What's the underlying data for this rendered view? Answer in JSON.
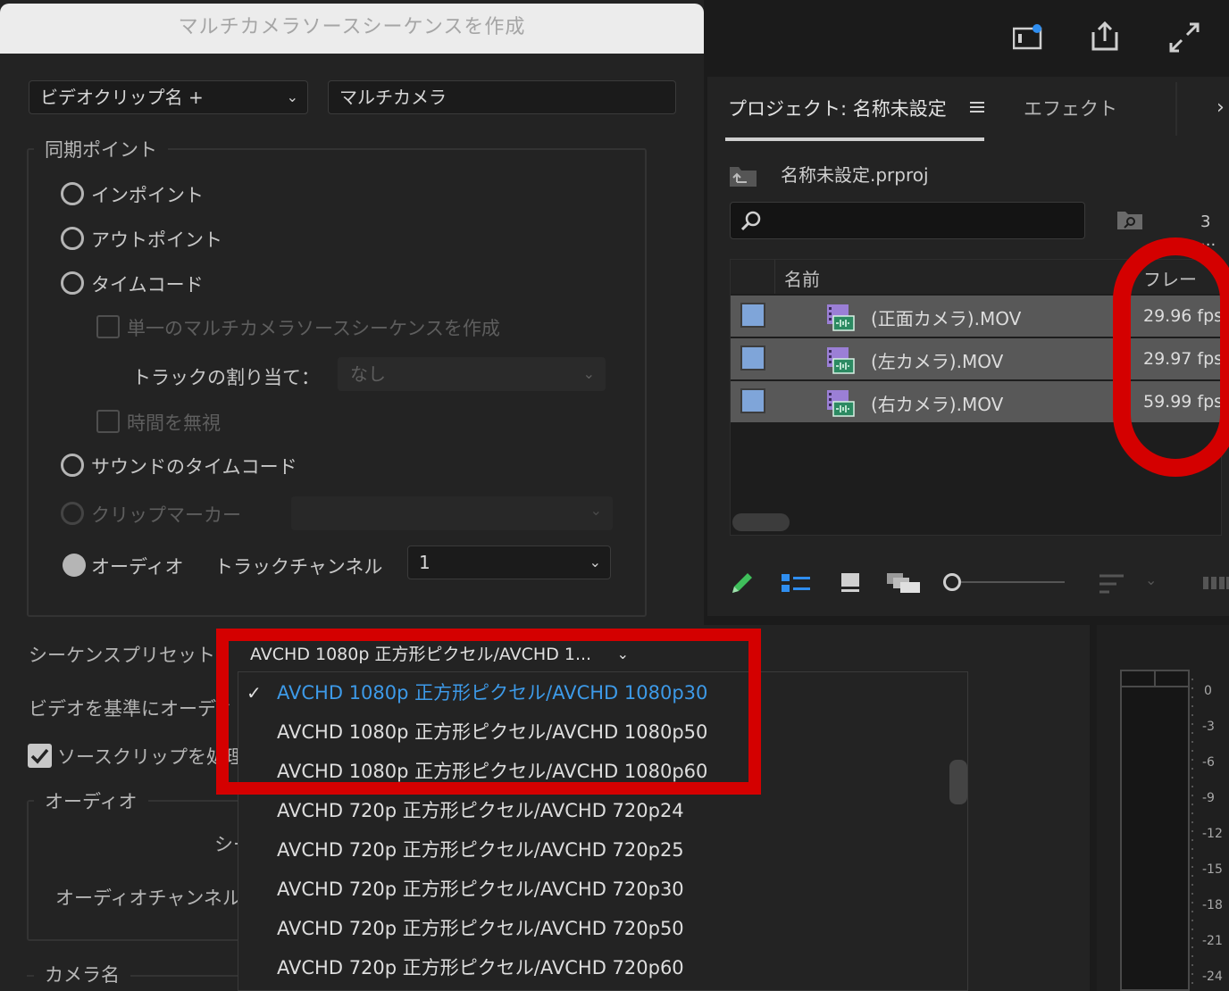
{
  "dialog": {
    "title": "マルチカメラソースシーケンスを作成",
    "name_mode_select": "ビデオクリップ名 +",
    "name_input": "マルチカメラ",
    "sync_group_label": "同期ポイント",
    "radios": [
      "インポイント",
      "アウトポイント",
      "タイムコード"
    ],
    "single_seq_checkbox": "単一のマルチカメラソースシーケンスを作成",
    "track_assign_label": "トラックの割り当て：",
    "track_assign_value": "なし",
    "ignore_time_checkbox": "時間を無視",
    "sound_timecode": "サウンドのタイムコード",
    "clip_marker": "クリップマーカー",
    "audio_radio": "オーディオ",
    "track_channel_label": "トラックチャンネル",
    "track_channel_value": "1",
    "sequence_preset_label": "シーケンスプリセット",
    "sequence_preset_value": "AVCHD 1080p 正方形ピクセル/AVCHD 1...",
    "video_base_label": "ビデオを基準にオーディ",
    "source_clip_label": "ソースクリップを処理",
    "audio_group_label": "オーディオ",
    "audio_seq_label": "シー",
    "audio_channel_label": "オーディオチャンネル",
    "camera_name_label": "カメラ名"
  },
  "preset_menu": {
    "items": [
      "AVCHD 1080p 正方形ピクセル/AVCHD 1080p30",
      "AVCHD 1080p 正方形ピクセル/AVCHD 1080p50",
      "AVCHD 1080p 正方形ピクセル/AVCHD 1080p60",
      "AVCHD 720p 正方形ピクセル/AVCHD 720p24",
      "AVCHD 720p 正方形ピクセル/AVCHD 720p25",
      "AVCHD 720p 正方形ピクセル/AVCHD 720p30",
      "AVCHD 720p 正方形ピクセル/AVCHD 720p50",
      "AVCHD 720p 正方形ピクセル/AVCHD 720p60"
    ],
    "selected_color": "#3d9ae8"
  },
  "project_panel": {
    "tab_project": "プロジェクト: 名称未設定",
    "tab_effects": "エフェクト",
    "project_file": "名称未設定.prproj",
    "item_count": "3 ...",
    "col_name": "名前",
    "col_frame": "フレー",
    "rows": [
      {
        "name": "(正面カメラ).MOV",
        "fps": "29.96 fps"
      },
      {
        "name": "(左カメラ).MOV",
        "fps": "29.97 fps"
      },
      {
        "name": "(右カメラ).MOV",
        "fps": "59.99 fps"
      }
    ]
  },
  "meter": {
    "ticks": [
      "0",
      "-3",
      "-6",
      "-9",
      "-12",
      "-15",
      "-18",
      "-21",
      "-24"
    ]
  },
  "annotation_color": "#d40000"
}
